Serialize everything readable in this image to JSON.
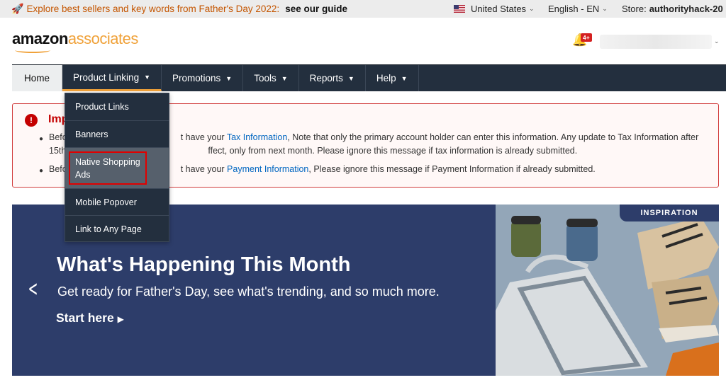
{
  "topbar": {
    "promo_text": "Explore best sellers and key words from Father's Day 2022:",
    "promo_link": "see our guide",
    "country": "United States",
    "language": "English - EN",
    "store_label": "Store:",
    "store_value": "authorityhack-20"
  },
  "header": {
    "logo_amazon": "amazon",
    "logo_associates": "associates",
    "notification_badge": "4+"
  },
  "nav": {
    "home": "Home",
    "product_linking": "Product Linking",
    "promotions": "Promotions",
    "tools": "Tools",
    "reports": "Reports",
    "help": "Help"
  },
  "dropdown": {
    "items": [
      "Product Links",
      "Banners",
      "Native Shopping Ads",
      "Mobile Popover",
      "Link to Any Page"
    ]
  },
  "alert": {
    "title": "Imp",
    "line1_pre": "Befo",
    "line1_mid": "t have your ",
    "line1_link": "Tax Information",
    "line1_post": ", Note that only the primary account holder can enter this information. Any update to Tax Information after",
    "line2_pre": "15th",
    "line2_post": "ffect, only from next month. Please ignore this message if tax information is already submitted.",
    "line3_pre": "Befo",
    "line3_mid": "t have your ",
    "line3_link": "Payment Information",
    "line3_post": ", Please ignore this message if Payment Information if already submitted."
  },
  "banner": {
    "title": "What's Happening This Month",
    "subtitle": "Get ready for Father's Day, see what's trending, and so much more.",
    "cta": "Start here",
    "tag": "INSPIRATION"
  },
  "colors": {
    "nav_bg": "#232f3e",
    "accent": "#f0a23a",
    "alert_red": "#c40000",
    "link_blue": "#0066c0",
    "banner_bg": "#2d3d6a"
  }
}
